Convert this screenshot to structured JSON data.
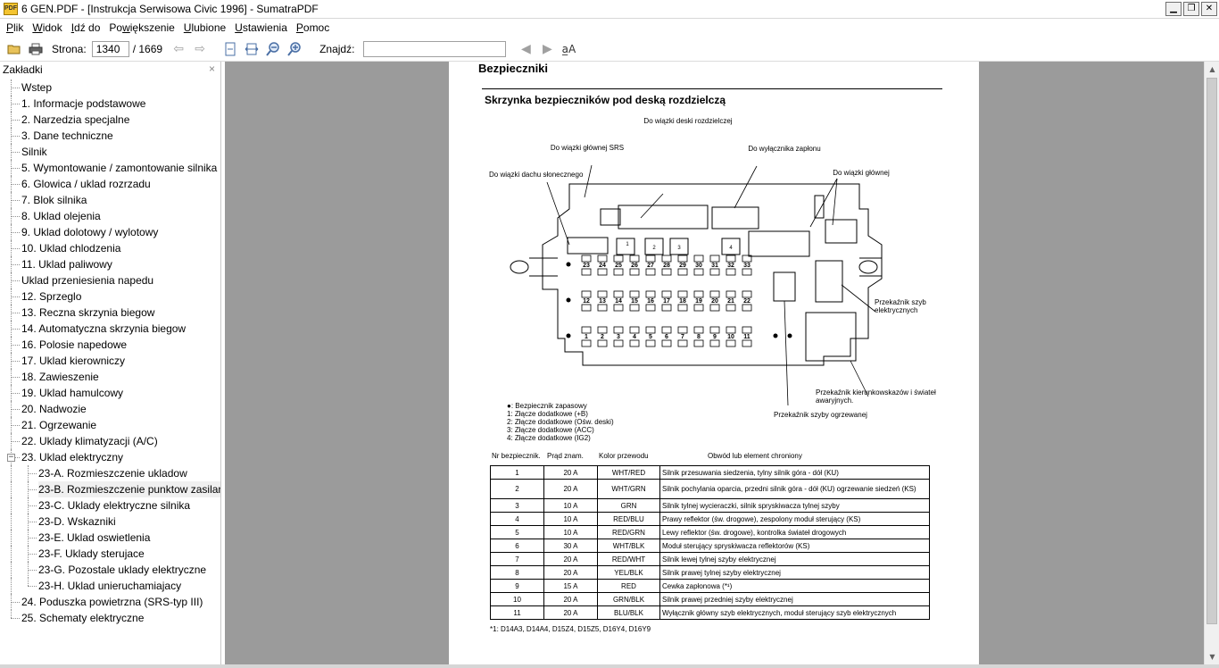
{
  "window": {
    "title": "6 GEN.PDF - [Instrukcja Serwisowa Civic 1996] - SumatraPDF",
    "app_icon_text": "PDF",
    "minimize": "▁",
    "restore": "❐",
    "close": "✕"
  },
  "menu": [
    {
      "pre": "",
      "ul": "P",
      "post": "lik"
    },
    {
      "pre": "",
      "ul": "W",
      "post": "idok"
    },
    {
      "pre": "",
      "ul": "I",
      "post": "dź do"
    },
    {
      "pre": "Po",
      "ul": "w",
      "post": "iększenie"
    },
    {
      "pre": "",
      "ul": "U",
      "post": "lubione"
    },
    {
      "pre": "",
      "ul": "U",
      "post": "stawienia"
    },
    {
      "pre": "",
      "ul": "P",
      "post": "omoc"
    }
  ],
  "toolbar": {
    "page_label": "Strona:",
    "page_value": "1340",
    "page_total": "/ 1669",
    "find_label": "Znajdź:",
    "find_value": "",
    "icons": [
      "open-icon",
      "print-icon",
      "back-icon",
      "forward-icon",
      "fit-page-icon",
      "fit-width-icon",
      "zoom-out-icon",
      "zoom-in-icon",
      "find-prev-icon",
      "find-next-icon",
      "match-case-icon"
    ]
  },
  "sidebar": {
    "title": "Zakładki",
    "close": "×",
    "items": [
      {
        "label": "Wstep",
        "level": 0
      },
      {
        "label": "1. Informacje podstawowe",
        "level": 0
      },
      {
        "label": "2. Narzedzia specjalne",
        "level": 0
      },
      {
        "label": "3. Dane techniczne",
        "level": 0
      },
      {
        "label": "Silnik",
        "level": 0
      },
      {
        "label": "5. Wymontowanie / zamontowanie silnika",
        "level": 0
      },
      {
        "label": "6. Glowica / uklad rozrzadu",
        "level": 0
      },
      {
        "label": "7. Blok silnika",
        "level": 0
      },
      {
        "label": "8. Uklad olejenia",
        "level": 0
      },
      {
        "label": "9. Uklad dolotowy / wylotowy",
        "level": 0
      },
      {
        "label": "10. Uklad chlodzenia",
        "level": 0
      },
      {
        "label": "11. Uklad paliwowy",
        "level": 0
      },
      {
        "label": "Uklad przeniesienia napedu",
        "level": 0
      },
      {
        "label": "12. Sprzeglo",
        "level": 0
      },
      {
        "label": "13. Reczna skrzynia biegow",
        "level": 0
      },
      {
        "label": "14. Automatyczna skrzynia biegow",
        "level": 0
      },
      {
        "label": "16. Polosie napedowe",
        "level": 0
      },
      {
        "label": "17. Uklad kierowniczy",
        "level": 0
      },
      {
        "label": "18. Zawieszenie",
        "level": 0
      },
      {
        "label": "19. Uklad hamulcowy",
        "level": 0
      },
      {
        "label": "20. Nadwozie",
        "level": 0
      },
      {
        "label": "21. Ogrzewanie",
        "level": 0
      },
      {
        "label": "22. Uklady klimatyzacji (A/C)",
        "level": 0
      },
      {
        "label": "23. Uklad elektryczny",
        "level": 0,
        "expander": "−"
      },
      {
        "label": "23-A. Rozmieszczenie ukladow",
        "level": 1
      },
      {
        "label": "23-B. Rozmieszczenie punktow zasilani",
        "level": 1,
        "selected": true
      },
      {
        "label": "23-C. Uklady elektryczne silnika",
        "level": 1
      },
      {
        "label": "23-D. Wskazniki",
        "level": 1
      },
      {
        "label": "23-E. Uklad oswietlenia",
        "level": 1
      },
      {
        "label": "23-F. Uklady sterujace",
        "level": 1
      },
      {
        "label": "23-G. Pozostale uklady elektryczne",
        "level": 1
      },
      {
        "label": "23-H. Uklad unieruchamiajacy",
        "level": 1
      },
      {
        "label": "24. Poduszka powietrzna (SRS-typ III)",
        "level": 0
      },
      {
        "label": "25. Schematy elektryczne",
        "level": 0
      }
    ]
  },
  "document": {
    "heading": "Bezpieczniki",
    "subheading": "Skrzynka bezpieczników pod deską rozdzielczą",
    "diagram_labels": {
      "dash_harness": "Do wiązki deski rozdzielczej",
      "srs_harness": "Do wiązki głównej SRS",
      "ignition": "Do wyłącznika zapłonu",
      "sunroof": "Do wiązki dachu słonecznego",
      "main_harness": "Do wiązki głównej",
      "window_relay": "Przekaźnik szyb elektrycznych",
      "turn_relay": "Przekaźnik kierunkowskazów i świateł awaryjnych.",
      "defrost_relay": "Przekaźnik szyby ogrzewanej",
      "fuse_row_top": [
        "23",
        "24",
        "25",
        "26",
        "27",
        "28",
        "29",
        "30",
        "31",
        "32",
        "33"
      ],
      "fuse_row_mid": [
        "12",
        "13",
        "14",
        "15",
        "16",
        "17",
        "18",
        "19",
        "20",
        "21",
        "22"
      ],
      "fuse_row_bot": [
        "1",
        "2",
        "3",
        "4",
        "5",
        "6",
        "7",
        "8",
        "9",
        "10",
        "11"
      ],
      "connector_nums": [
        "1",
        "2",
        "3",
        "4"
      ]
    },
    "legend": [
      "●: Bezpiecznik zapasowy",
      "1:  Złącze dodatkowe (+B)",
      "2:  Złącze dodatkowe (Ośw. deski)",
      "3:  Złącze dodatkowe (ACC)",
      "4:  Złącze dodatkowe (IG2)"
    ],
    "table_headers": [
      "Nr bezpiecznik.",
      "Prąd znam.",
      "Kolor przewodu",
      "Obwód lub element chroniony"
    ],
    "table_rows": [
      [
        "1",
        "20 A",
        "WHT/RED",
        "Silnik przesuwania siedzenia, tylny silnik góra - dół (KU)"
      ],
      [
        "2",
        "20 A",
        "WHT/GRN",
        "Silnik pochylania oparcia, przedni silnik góra - dół (KU) ogrzewanie siedzeń (KS)"
      ],
      [
        "3",
        "10 A",
        "GRN",
        "Silnik tylnej wycieraczki, silnik spryskiwacza tylnej szyby"
      ],
      [
        "4",
        "10 A",
        "RED/BLU",
        "Prawy reflektor (św. drogowe), zespolony moduł sterujący (KS)"
      ],
      [
        "5",
        "10 A",
        "RED/GRN",
        "Lewy reflektor (św. drogowe), kontrolka świateł drogowych"
      ],
      [
        "6",
        "30 A",
        "WHT/BLK",
        "Moduł sterujący spryskiwacza reflektorów (KS)"
      ],
      [
        "7",
        "20 A",
        "RED/WHT",
        "Silnik lewej tylnej szyby elektrycznej"
      ],
      [
        "8",
        "20 A",
        "YEL/BLK",
        "Silnik prawej tylnej szyby elektrycznej"
      ],
      [
        "9",
        "15 A",
        "RED",
        "Cewka zapłonowa (*¹)"
      ],
      [
        "10",
        "20 A",
        "GRN/BLK",
        "Silnik prawej przedniej szyby elektrycznej"
      ],
      [
        "11",
        "20 A",
        "BLU/BLK",
        "Wyłącznik główny szyb elektrycznych, moduł sterujący szyb elektrycznych"
      ]
    ],
    "footnote": "*1: D14A3, D14A4, D15Z4, D15Z5, D16Y4, D16Y9"
  },
  "scrollbar": {
    "up": "▲",
    "down": "▼"
  }
}
